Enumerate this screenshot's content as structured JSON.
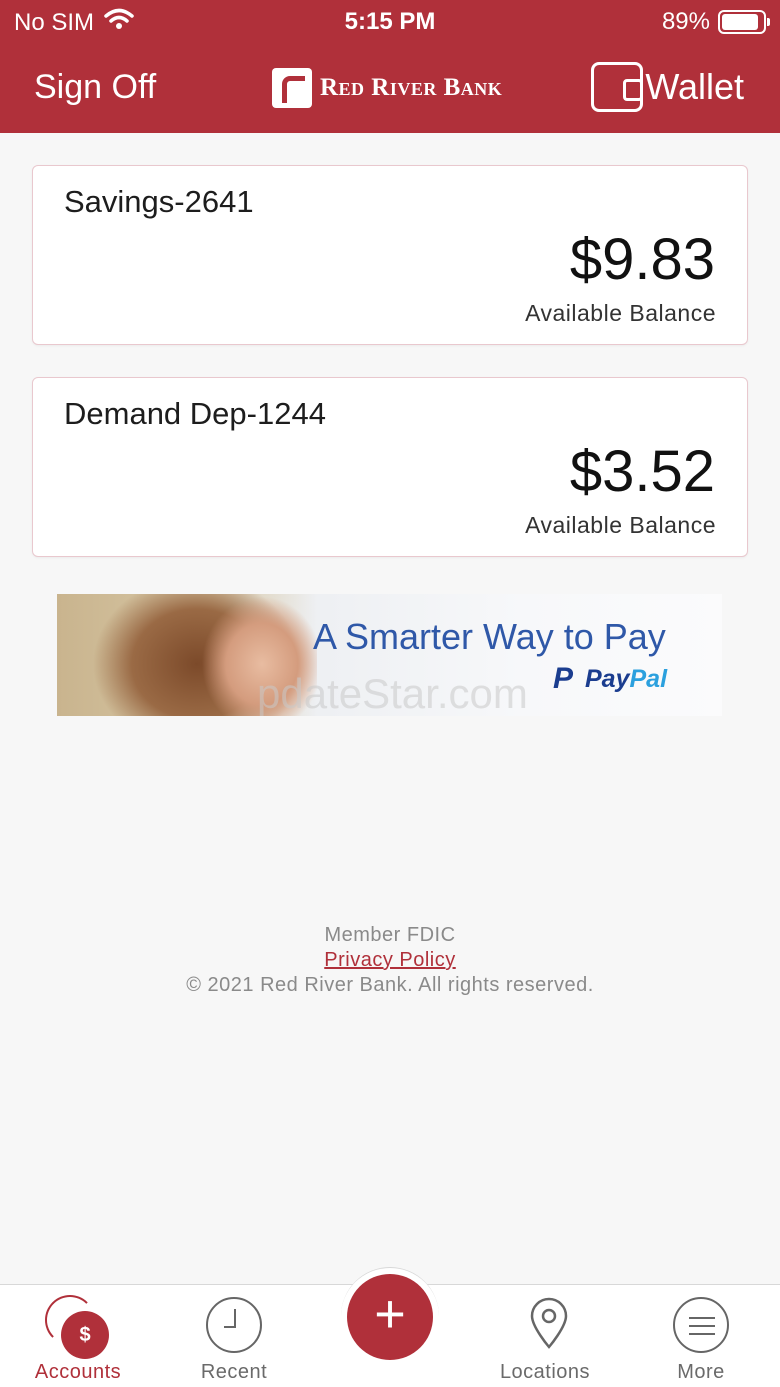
{
  "status_bar": {
    "carrier": "No SIM",
    "time": "5:15 PM",
    "battery": "89%",
    "battery_level": 0.89,
    "icons": [
      "wifi-icon",
      "battery-icon"
    ]
  },
  "header": {
    "sign_off": "Sign Off",
    "brand": "Red River Bank",
    "wallet": "Wallet",
    "color": "#b0303a"
  },
  "accounts": [
    {
      "name": "Savings-2641",
      "amount": "$9.83",
      "caption": "Available Balance"
    },
    {
      "name": "Demand Dep-1244",
      "amount": "$3.52",
      "caption": "Available Balance"
    }
  ],
  "ad": {
    "headline": "A Smarter Way to Pay",
    "brand_part1": "Pay",
    "brand_part2": "Pal",
    "watermark": "pdateStar.com"
  },
  "footer": {
    "member": "Member FDIC",
    "privacy": "Privacy Policy",
    "copyright": "© 2021 Red River Bank. All rights reserved."
  },
  "tabbar": {
    "accounts": "Accounts",
    "recent": "Recent",
    "locations": "Locations",
    "more": "More",
    "dollar": "$",
    "plus": "+"
  }
}
